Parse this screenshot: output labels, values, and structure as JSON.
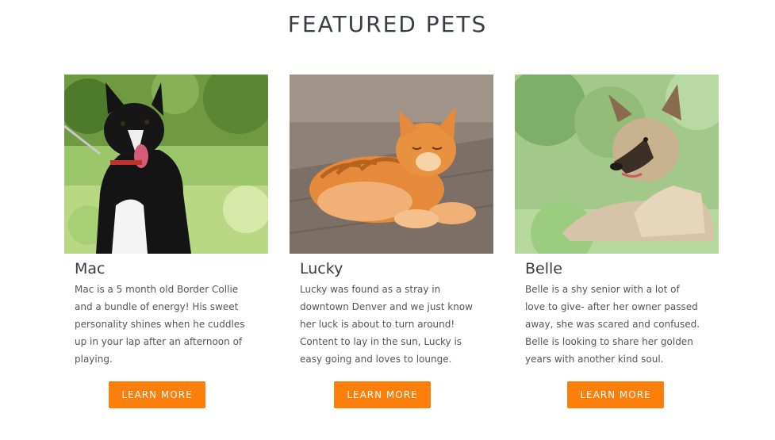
{
  "section": {
    "title": "FEATURED PETS"
  },
  "pets": [
    {
      "name": "Mac",
      "description": "Mac is a 5 month old Border Collie and a bundle of energy! His sweet personality shines when he cuddles up in your lap after an afternoon of playing.",
      "button_label": "LEARN MORE"
    },
    {
      "name": "Lucky",
      "description": "Lucky was found as a stray in downtown Denver and we just know her luck is about to turn around! Content to lay in the sun, Lucky is easy going and loves to lounge.",
      "button_label": "LEARN MORE"
    },
    {
      "name": "Belle",
      "description": "Belle is a shy senior with a lot of love to give- after her owner passed away, she was scared and confused. Belle is looking to share her golden years with another kind soul.",
      "button_label": "LEARN MORE"
    }
  ],
  "colors": {
    "accent": "#fb7f0a",
    "heading": "#3a3f45",
    "body_text": "#555555"
  }
}
